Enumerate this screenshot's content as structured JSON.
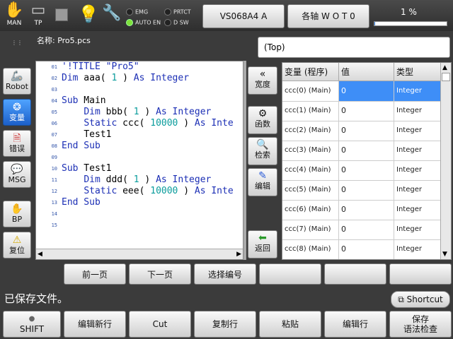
{
  "topbar": {
    "icons": [
      {
        "name": "man-hand-icon",
        "label": "MAN"
      },
      {
        "name": "tp-icon",
        "label": "TP"
      }
    ],
    "leds": [
      "EMG",
      "PRTCT",
      "AUTO EN",
      "D SW"
    ],
    "robot_button": "VS068A4 A",
    "axis_button": "各轴 W O T 0",
    "speed": "1 %"
  },
  "file": {
    "label": "名称: Pro5.pcs",
    "scope": "(Top)"
  },
  "side_buttons": [
    {
      "label": "Robot",
      "icon": "robot-icon"
    },
    {
      "label": "变量",
      "icon": "variable-icon"
    },
    {
      "label": "错误",
      "icon": "error-icon"
    },
    {
      "label": "MSG",
      "icon": "message-icon"
    },
    {
      "label": "BP",
      "icon": "breakpoint-hand-icon"
    },
    {
      "label": "复位",
      "icon": "warning-icon"
    }
  ],
  "editor": {
    "line_numbers": [
      "01",
      "02",
      "03",
      "04",
      "05",
      "06",
      "07",
      "08",
      "09",
      "10",
      "11",
      "12",
      "13",
      "14",
      "15"
    ],
    "code": {
      "l01": "'!TITLE \"Pro5\"",
      "l02_kw1": "Dim",
      "l02_name": " aaa( ",
      "l02_num": "1",
      "l02_rest": " ) ",
      "l02_kw2": "As Integer",
      "l04_kw": "Sub",
      "l04_rest": " Main",
      "l05_kw1": "Dim",
      "l05_name": " bbb( ",
      "l05_num": "1",
      "l05_rest": " ) ",
      "l05_kw2": "As Integer",
      "l06_kw1": "Static",
      "l06_name": " ccc( ",
      "l06_num": "10000",
      "l06_rest": " ) ",
      "l06_kw2": "As Inte",
      "l07": "Test1",
      "l08": "End Sub",
      "l10_kw": "Sub",
      "l10_rest": " Test1",
      "l11_kw1": "Dim",
      "l11_name": " ddd( ",
      "l11_num": "1",
      "l11_rest": " ) ",
      "l11_kw2": "As Integer",
      "l12_kw1": "Static",
      "l12_name": " eee( ",
      "l12_num": "10000",
      "l12_rest": " ) ",
      "l12_kw2": "As Inte",
      "l13": "End Sub"
    }
  },
  "mid_buttons": [
    {
      "label": "宽度",
      "icon": "double-chevron-left-icon"
    },
    {
      "label": "函数",
      "icon": "function-icon"
    },
    {
      "label": "检索",
      "icon": "search-icon"
    },
    {
      "label": "编辑",
      "icon": "pencil-icon"
    },
    {
      "label": "返回",
      "icon": "back-arrow-icon"
    }
  ],
  "var_table": {
    "headers": [
      "变量 (程序)",
      "值",
      "类型"
    ],
    "rows": [
      {
        "name": "ccc(0) (Main)",
        "value": "0",
        "type": "Integer"
      },
      {
        "name": "ccc(1) (Main)",
        "value": "0",
        "type": "Integer"
      },
      {
        "name": "ccc(2) (Main)",
        "value": "0",
        "type": "Integer"
      },
      {
        "name": "ccc(3) (Main)",
        "value": "0",
        "type": "Integer"
      },
      {
        "name": "ccc(4) (Main)",
        "value": "0",
        "type": "Integer"
      },
      {
        "name": "ccc(5) (Main)",
        "value": "0",
        "type": "Integer"
      },
      {
        "name": "ccc(6) (Main)",
        "value": "0",
        "type": "Integer"
      },
      {
        "name": "ccc(7) (Main)",
        "value": "0",
        "type": "Integer"
      },
      {
        "name": "ccc(8) (Main)",
        "value": "0",
        "type": "Integer"
      }
    ]
  },
  "func_buttons": [
    "前一页",
    "下一页",
    "选择编号",
    "",
    "",
    ""
  ],
  "status_message": "已保存文件。",
  "shortcut": "Shortcut",
  "bottom_buttons": {
    "shift": "SHIFT",
    "b1": "编辑新行",
    "b2": "Cut",
    "b3": "复制行",
    "b4": "粘贴",
    "b5": "编辑行",
    "b6a": "保存",
    "b6b": "语法检查"
  },
  "colors": {
    "accent": "#3e8ef7",
    "background": "#3b3b3b"
  }
}
